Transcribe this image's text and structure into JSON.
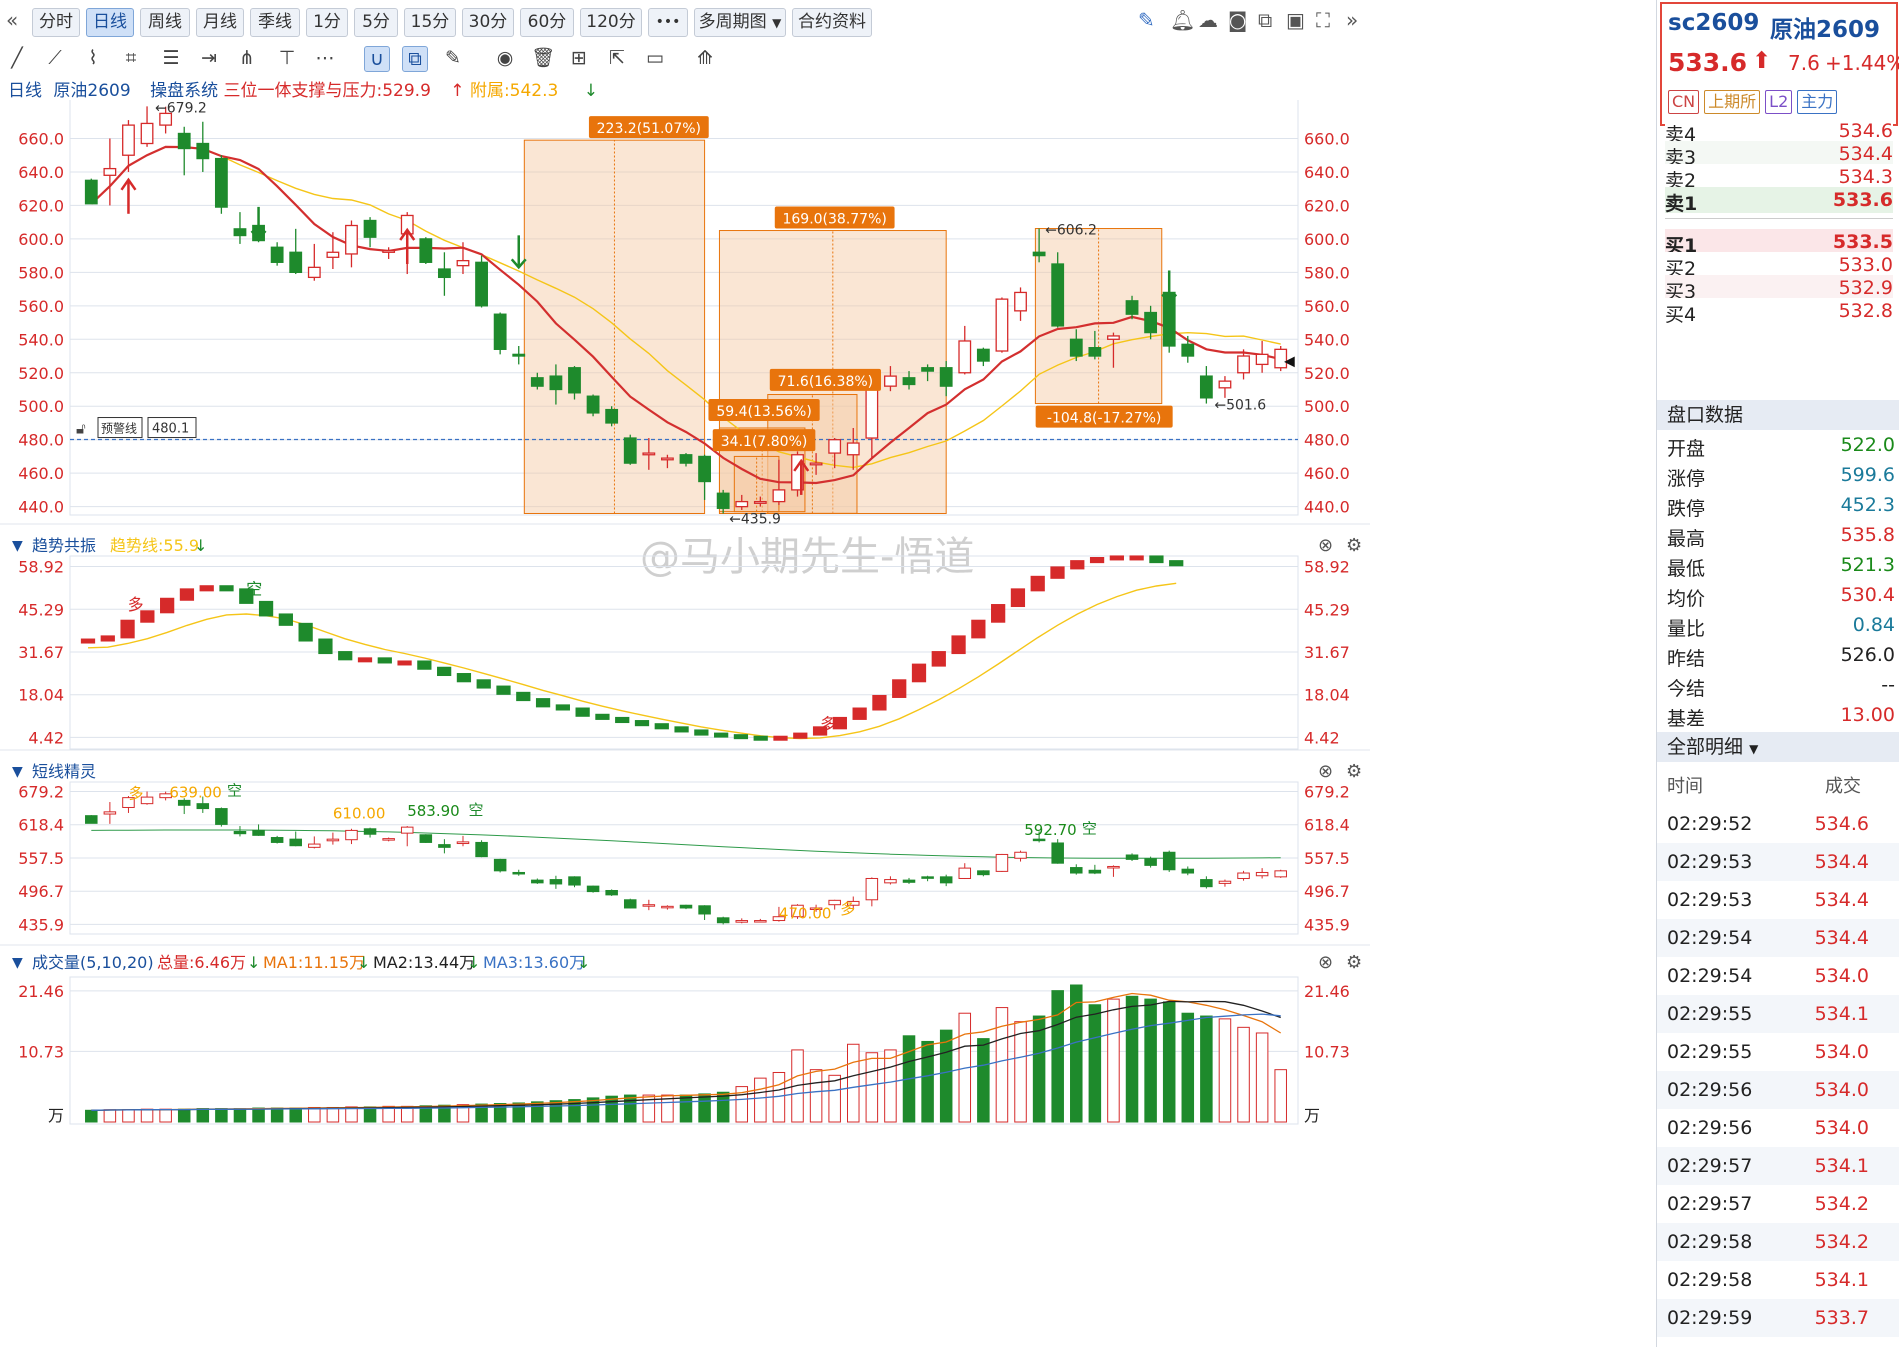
{
  "toolbar": {
    "collapse_icon": "double-chevron-left-icon",
    "periods": [
      {
        "label": "分时",
        "active": false
      },
      {
        "label": "日线",
        "active": true
      },
      {
        "label": "周线",
        "active": false
      },
      {
        "label": "月线",
        "active": false
      },
      {
        "label": "季线",
        "active": false
      },
      {
        "label": "1分",
        "active": false
      },
      {
        "label": "5分",
        "active": false
      },
      {
        "label": "15分",
        "active": false
      },
      {
        "label": "30分",
        "active": false
      },
      {
        "label": "60分",
        "active": false
      },
      {
        "label": "120分",
        "active": false
      }
    ],
    "more_label": "•••",
    "multi_period_label": "多周期图",
    "contract_info_label": "合约资料",
    "right_icons": [
      "pen-icon",
      "bell-icon",
      "cloud-icon",
      "camera-icon",
      "windows-icon",
      "monitor-icon",
      "fullscreen-icon",
      "double-chevron-right-icon"
    ]
  },
  "drawing_tools": [
    "line-tool-icon",
    "ray-tool-icon",
    "polyline-tool-icon",
    "crop-tool-icon",
    "fib-tool-icon",
    "range-tool-icon",
    "fan-tool-icon",
    "gann-tool-icon",
    "more-tools-icon",
    "magnet-icon",
    "overlay-icon",
    "pen-tool-icon",
    "eye-icon",
    "trash-icon",
    "settings-grid-icon",
    "export-icon",
    "comment-icon",
    "ruler-icon"
  ],
  "info": {
    "period_label": "日线",
    "symbol_name": "原油2609",
    "system_label": "操盘系统",
    "support_label": "三位一体支撑与压力:529.9",
    "attached_label": "附属:542.3"
  },
  "chart_controls": [
    "undo-icon",
    "zoom-in-icon",
    "zoom-out-icon",
    "layout-icon",
    "settings-icon"
  ],
  "watermark": "@马小期先生-悟道",
  "alert": {
    "label": "预警线",
    "value": "480.1"
  },
  "chart_data": {
    "type": "candlestick",
    "main": {
      "yticks": [
        "660.0",
        "640.0",
        "620.0",
        "600.0",
        "580.0",
        "560.0",
        "540.0",
        "520.0",
        "500.0",
        "480.0",
        "460.0",
        "440.0"
      ],
      "ylim": [
        435,
        683
      ],
      "alert_line": 480.1,
      "candles": [
        [
          635,
          621,
          622,
          636
        ],
        [
          638,
          642,
          620,
          660
        ],
        [
          650,
          668,
          640,
          671
        ],
        [
          657,
          669,
          655,
          679.2
        ],
        [
          668,
          675,
          663,
          679
        ],
        [
          663,
          654,
          638,
          667
        ],
        [
          657,
          648,
          640,
          670
        ],
        [
          648,
          619,
          615,
          650
        ],
        [
          606,
          602,
          597,
          616
        ],
        [
          608,
          599,
          598,
          619
        ],
        [
          595,
          586,
          584,
          598
        ],
        [
          592,
          580,
          579,
          606
        ],
        [
          577,
          583,
          575,
          597
        ],
        [
          589,
          592,
          582,
          604
        ],
        [
          591,
          608,
          583,
          611
        ],
        [
          611,
          601,
          595,
          613
        ],
        [
          592,
          593,
          588,
          595
        ],
        [
          603,
          614,
          579,
          616
        ],
        [
          600,
          586,
          585,
          601
        ],
        [
          582,
          577,
          566,
          592
        ],
        [
          584,
          587,
          579,
          598
        ],
        [
          586,
          560,
          559,
          590
        ],
        [
          555,
          534,
          531,
          556
        ],
        [
          531,
          530,
          525,
          536
        ],
        [
          517,
          512,
          510,
          520
        ],
        [
          518,
          510,
          501,
          525
        ],
        [
          523,
          508,
          504,
          524
        ],
        [
          506,
          496,
          494,
          507
        ],
        [
          498,
          490,
          488,
          500
        ],
        [
          481,
          466,
          465,
          483
        ],
        [
          471,
          472,
          462,
          481
        ],
        [
          468,
          469,
          463,
          471
        ],
        [
          471,
          466,
          464,
          472
        ],
        [
          470,
          455,
          444,
          471
        ],
        [
          448,
          439,
          435.9,
          450
        ],
        [
          440,
          443,
          438,
          447
        ],
        [
          442,
          443,
          440,
          446
        ],
        [
          443,
          450,
          441,
          468
        ],
        [
          450,
          471,
          446,
          473
        ],
        [
          465,
          466,
          459,
          472
        ],
        [
          472,
          480,
          463,
          481
        ],
        [
          471,
          478,
          462,
          487
        ],
        [
          481,
          520,
          469,
          522
        ],
        [
          512,
          518,
          509,
          524
        ],
        [
          517,
          513,
          510,
          521
        ],
        [
          523,
          521,
          515,
          525
        ],
        [
          523,
          512,
          506,
          527
        ],
        [
          520,
          539,
          519,
          548
        ],
        [
          534,
          527,
          524,
          535
        ],
        [
          533,
          564,
          532,
          565
        ],
        [
          557,
          568,
          551,
          571
        ],
        [
          592,
          590,
          586,
          606.2
        ],
        [
          585,
          548,
          547,
          592
        ],
        [
          540,
          530,
          527,
          546
        ],
        [
          535,
          530,
          528,
          545
        ],
        [
          540,
          542,
          523,
          544
        ],
        [
          563,
          555,
          552,
          566
        ],
        [
          556,
          544,
          540,
          560
        ],
        [
          568,
          536,
          532,
          571
        ],
        [
          537,
          530,
          526,
          542
        ],
        [
          518,
          505,
          501.6,
          524
        ],
        [
          511,
          515,
          505,
          518
        ],
        [
          520,
          530,
          516,
          534
        ],
        [
          525,
          531,
          520,
          539
        ],
        [
          523,
          534,
          521,
          536
        ]
      ],
      "annotations": {
        "high_label": "←679.2",
        "low_label": "←435.9",
        "swing_high_label": "←606.2",
        "swing_low_label": "←501.6",
        "boxes": [
          "223.2(51.07%)",
          "169.0(38.77%)",
          "71.6(16.38%)",
          "59.4(13.56%)",
          "34.1(7.80%)",
          "-104.8(-17.27%)"
        ]
      }
    },
    "trend": {
      "title": "趋势共振",
      "trendline_label": "趋势线:55.9",
      "yticks": [
        "58.92",
        "45.29",
        "31.67",
        "18.04",
        "4.42"
      ],
      "ylim": [
        2,
        61
      ],
      "values": [
        35,
        36,
        41,
        44,
        48,
        51,
        52,
        51,
        47,
        43,
        40,
        35,
        31,
        29,
        29,
        28,
        28,
        26,
        24,
        22,
        20,
        18,
        16,
        14,
        13,
        11,
        10,
        9,
        8,
        7,
        6,
        5,
        4.5,
        4,
        3.5,
        4,
        5,
        7,
        10,
        13,
        17,
        22,
        27,
        31,
        36,
        41,
        46,
        51,
        55,
        58,
        60,
        61,
        61.5,
        61.5,
        60,
        59
      ],
      "signals": [
        "多",
        "空",
        "多"
      ]
    },
    "short": {
      "title": "短线精灵",
      "yticks": [
        "679.2",
        "618.4",
        "557.5",
        "496.7",
        "435.9"
      ],
      "ylim": [
        433,
        682
      ],
      "labels": [
        "639.00",
        "空",
        "多",
        "610.00",
        "583.90",
        "空",
        "470.00",
        "多",
        "592.70",
        "空"
      ]
    },
    "volume": {
      "title": "成交量(5,10,20)",
      "total_label": "总量:6.46万",
      "ma1_label": "MA1:11.15万",
      "ma2_label": "MA2:13.44万",
      "ma3_label": "MA3:13.60万",
      "yticks": [
        "21.46",
        "10.73",
        "万"
      ],
      "ylim": [
        0,
        22.5
      ],
      "values": [
        0.3,
        0.4,
        0.4,
        0.5,
        0.5,
        0.5,
        0.6,
        0.6,
        0.6,
        0.7,
        0.7,
        0.7,
        0.8,
        0.8,
        0.9,
        0.9,
        1.0,
        1.0,
        1.1,
        1.2,
        1.3,
        1.4,
        1.5,
        1.6,
        1.8,
        2.0,
        2.2,
        2.5,
        2.8,
        3.0,
        3.0,
        3.0,
        3.0,
        3.2,
        3.5,
        4.5,
        6.0,
        7.0,
        11.0,
        7.5,
        6.5,
        12.0,
        10.5,
        11.0,
        13.5,
        12.5,
        14.5,
        17.5,
        13.0,
        18.5,
        16.0,
        17.0,
        21.5,
        24.0,
        19.0,
        20.0,
        20.5,
        20.0,
        19.5,
        17.5,
        17.0,
        16.5,
        15.0,
        14.0,
        7.5
      ]
    }
  },
  "quote": {
    "code": "sc2609",
    "name": "原油2609",
    "price": "533.6",
    "change": "7.6",
    "change_pct": "+1.44%",
    "tags": [
      "CN",
      "上期所",
      "L2",
      "主力"
    ]
  },
  "orderbook": {
    "asks": [
      {
        "label": "卖4",
        "price": "534.6"
      },
      {
        "label": "卖3",
        "price": "534.4"
      },
      {
        "label": "卖2",
        "price": "534.3"
      },
      {
        "label": "卖1",
        "price": "533.6"
      }
    ],
    "bids": [
      {
        "label": "买1",
        "price": "533.5"
      },
      {
        "label": "买2",
        "price": "533.0"
      },
      {
        "label": "买3",
        "price": "532.9"
      },
      {
        "label": "买4",
        "price": "532.8"
      }
    ]
  },
  "pankou": {
    "title": "盘口数据",
    "rows": [
      {
        "label": "开盘",
        "value": "522.0",
        "color": "#1a8a1a"
      },
      {
        "label": "涨停",
        "value": "599.6",
        "color": "#1a7a9a"
      },
      {
        "label": "跌停",
        "value": "452.3",
        "color": "#1a7a9a"
      },
      {
        "label": "最高",
        "value": "535.8",
        "color": "#d62a2a"
      },
      {
        "label": "最低",
        "value": "521.3",
        "color": "#1a8a1a"
      },
      {
        "label": "均价",
        "value": "530.4",
        "color": "#d62a2a"
      },
      {
        "label": "量比",
        "value": "0.84",
        "color": "#1a7a9a"
      },
      {
        "label": "昨结",
        "value": "526.0",
        "color": "#222"
      },
      {
        "label": "今结",
        "value": "--",
        "color": "#222"
      },
      {
        "label": "基差",
        "value": "13.00",
        "color": "#d62a2a"
      }
    ]
  },
  "trades": {
    "title": "全部明细",
    "col_time": "时间",
    "col_price": "成交",
    "rows": [
      {
        "time": "02:29:52",
        "price": "534.6"
      },
      {
        "time": "02:29:53",
        "price": "534.4"
      },
      {
        "time": "02:29:53",
        "price": "534.4"
      },
      {
        "time": "02:29:54",
        "price": "534.4"
      },
      {
        "time": "02:29:54",
        "price": "534.0"
      },
      {
        "time": "02:29:55",
        "price": "534.1"
      },
      {
        "time": "02:29:55",
        "price": "534.0"
      },
      {
        "time": "02:29:56",
        "price": "534.0"
      },
      {
        "time": "02:29:56",
        "price": "534.0"
      },
      {
        "time": "02:29:57",
        "price": "534.1"
      },
      {
        "time": "02:29:57",
        "price": "534.2"
      },
      {
        "time": "02:29:58",
        "price": "534.2"
      },
      {
        "time": "02:29:58",
        "price": "534.1"
      },
      {
        "time": "02:29:59",
        "price": "533.7"
      }
    ]
  },
  "colors": {
    "up": "#d62a2a",
    "down": "#1e8a2c",
    "ma_red": "#d32f2f",
    "ma_yellow": "#f5c518",
    "box_fill": "#f5c8a0",
    "box_label": "#e8740c",
    "grid": "#dde3ec",
    "accent": "#1a4f9c"
  }
}
